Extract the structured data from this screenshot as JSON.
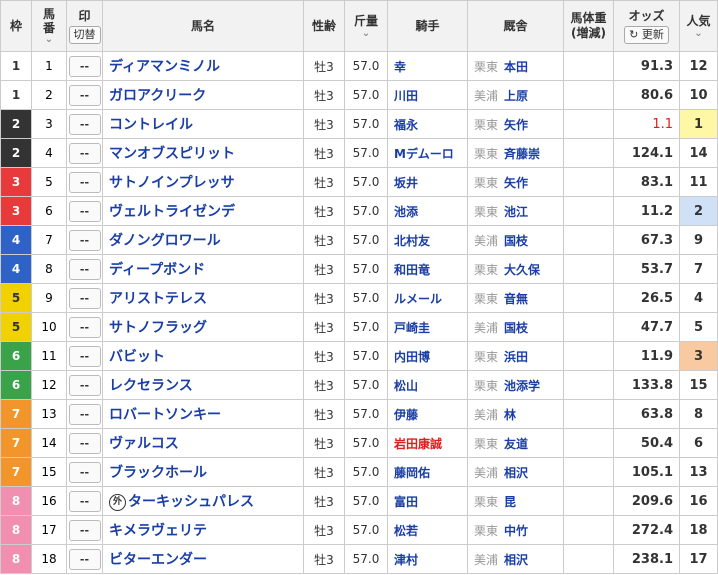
{
  "header": {
    "waku": "枠",
    "umaban": "馬番",
    "mark": "印",
    "mark_toggle": "切替",
    "horse_name": "馬名",
    "sex_age": "性齢",
    "weight": "斤量",
    "jockey": "騎手",
    "stable": "厩舎",
    "body_weight": "馬体重",
    "body_weight_change": "(増減)",
    "odds": "オッズ",
    "odds_refresh": "更新",
    "popularity": "人気",
    "sort_icon": "chevron-down-icon"
  },
  "colors": {
    "waku": {
      "1": "#ffffff",
      "2": "#333333",
      "3": "#e83a3a",
      "4": "#2f62c7",
      "5": "#f2d100",
      "6": "#3aa34a",
      "7": "#f2962b",
      "8": "#f18fb0"
    },
    "popularity_1": "#fdf7a6",
    "popularity_2": "#cfe0f7",
    "popularity_3": "#f9c9a1",
    "link": "#1a3ea5",
    "accent_red": "#e21b1b"
  },
  "rows": [
    {
      "waku": "1",
      "umaban": "1",
      "mark": "--",
      "name": "ディアマンミノル",
      "foreign": "",
      "sex_age": "牡3",
      "weight": "57.0",
      "jockey": "幸",
      "region": "栗東",
      "trainer": "本田",
      "odds": "91.3",
      "pop": "12"
    },
    {
      "waku": "1",
      "umaban": "2",
      "mark": "--",
      "name": "ガロアクリーク",
      "foreign": "",
      "sex_age": "牡3",
      "weight": "57.0",
      "jockey": "川田",
      "region": "美浦",
      "trainer": "上原",
      "odds": "80.6",
      "pop": "10"
    },
    {
      "waku": "2",
      "umaban": "3",
      "mark": "--",
      "name": "コントレイル",
      "foreign": "",
      "sex_age": "牡3",
      "weight": "57.0",
      "jockey": "福永",
      "region": "栗東",
      "trainer": "矢作",
      "odds": "1.1",
      "pop": "1"
    },
    {
      "waku": "2",
      "umaban": "4",
      "mark": "--",
      "name": "マンオブスピリット",
      "foreign": "",
      "sex_age": "牡3",
      "weight": "57.0",
      "jockey": "Mデムーロ",
      "region": "栗東",
      "trainer": "斉藤崇",
      "odds": "124.1",
      "pop": "14"
    },
    {
      "waku": "3",
      "umaban": "5",
      "mark": "--",
      "name": "サトノインプレッサ",
      "foreign": "",
      "sex_age": "牡3",
      "weight": "57.0",
      "jockey": "坂井",
      "region": "栗東",
      "trainer": "矢作",
      "odds": "83.1",
      "pop": "11"
    },
    {
      "waku": "3",
      "umaban": "6",
      "mark": "--",
      "name": "ヴェルトライゼンデ",
      "foreign": "",
      "sex_age": "牡3",
      "weight": "57.0",
      "jockey": "池添",
      "region": "栗東",
      "trainer": "池江",
      "odds": "11.2",
      "pop": "2"
    },
    {
      "waku": "4",
      "umaban": "7",
      "mark": "--",
      "name": "ダノングロワール",
      "foreign": "",
      "sex_age": "牡3",
      "weight": "57.0",
      "jockey": "北村友",
      "region": "美浦",
      "trainer": "国枝",
      "odds": "67.3",
      "pop": "9"
    },
    {
      "waku": "4",
      "umaban": "8",
      "mark": "--",
      "name": "ディープボンド",
      "foreign": "",
      "sex_age": "牡3",
      "weight": "57.0",
      "jockey": "和田竜",
      "region": "栗東",
      "trainer": "大久保",
      "odds": "53.7",
      "pop": "7"
    },
    {
      "waku": "5",
      "umaban": "9",
      "mark": "--",
      "name": "アリストテレス",
      "foreign": "",
      "sex_age": "牡3",
      "weight": "57.0",
      "jockey": "ルメール",
      "region": "栗東",
      "trainer": "音無",
      "odds": "26.5",
      "pop": "4"
    },
    {
      "waku": "5",
      "umaban": "10",
      "mark": "--",
      "name": "サトノフラッグ",
      "foreign": "",
      "sex_age": "牡3",
      "weight": "57.0",
      "jockey": "戸崎圭",
      "region": "美浦",
      "trainer": "国枝",
      "odds": "47.7",
      "pop": "5"
    },
    {
      "waku": "6",
      "umaban": "11",
      "mark": "--",
      "name": "バビット",
      "foreign": "",
      "sex_age": "牡3",
      "weight": "57.0",
      "jockey": "内田博",
      "region": "栗東",
      "trainer": "浜田",
      "odds": "11.9",
      "pop": "3"
    },
    {
      "waku": "6",
      "umaban": "12",
      "mark": "--",
      "name": "レクセランス",
      "foreign": "",
      "sex_age": "牡3",
      "weight": "57.0",
      "jockey": "松山",
      "region": "栗東",
      "trainer": "池添学",
      "odds": "133.8",
      "pop": "15"
    },
    {
      "waku": "7",
      "umaban": "13",
      "mark": "--",
      "name": "ロバートソンキー",
      "foreign": "",
      "sex_age": "牡3",
      "weight": "57.0",
      "jockey": "伊藤",
      "region": "美浦",
      "trainer": "林",
      "odds": "63.8",
      "pop": "8"
    },
    {
      "waku": "7",
      "umaban": "14",
      "mark": "--",
      "name": "ヴァルコス",
      "foreign": "",
      "sex_age": "牡3",
      "weight": "57.0",
      "jockey": "岩田康誠",
      "region": "栗東",
      "trainer": "友道",
      "odds": "50.4",
      "pop": "6"
    },
    {
      "waku": "7",
      "umaban": "15",
      "mark": "--",
      "name": "ブラックホール",
      "foreign": "",
      "sex_age": "牡3",
      "weight": "57.0",
      "jockey": "藤岡佑",
      "region": "美浦",
      "trainer": "相沢",
      "odds": "105.1",
      "pop": "13"
    },
    {
      "waku": "8",
      "umaban": "16",
      "mark": "--",
      "name": "ターキッシュパレス",
      "foreign": "外",
      "sex_age": "牡3",
      "weight": "57.0",
      "jockey": "富田",
      "region": "栗東",
      "trainer": "昆",
      "odds": "209.6",
      "pop": "16"
    },
    {
      "waku": "8",
      "umaban": "17",
      "mark": "--",
      "name": "キメラヴェリテ",
      "foreign": "",
      "sex_age": "牡3",
      "weight": "57.0",
      "jockey": "松若",
      "region": "栗東",
      "trainer": "中竹",
      "odds": "272.4",
      "pop": "18"
    },
    {
      "waku": "8",
      "umaban": "18",
      "mark": "--",
      "name": "ビターエンダー",
      "foreign": "",
      "sex_age": "牡3",
      "weight": "57.0",
      "jockey": "津村",
      "region": "美浦",
      "trainer": "相沢",
      "odds": "238.1",
      "pop": "17"
    }
  ]
}
